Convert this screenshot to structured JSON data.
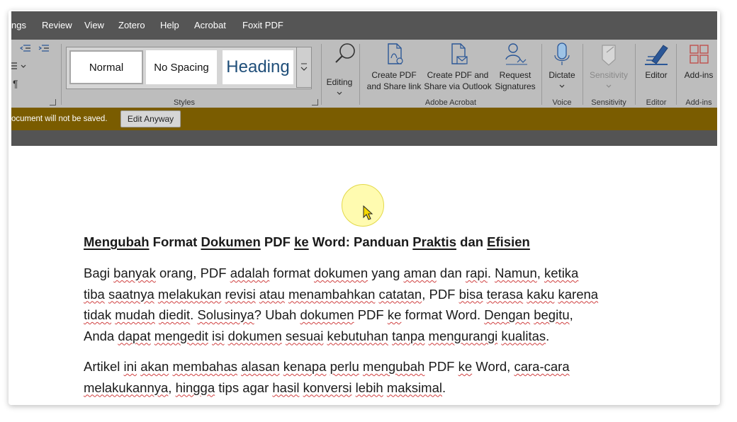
{
  "tabs": [
    "ngs",
    "Review",
    "View",
    "Zotero",
    "Help",
    "Acrobat",
    "Foxit PDF"
  ],
  "styles": {
    "items": [
      "Normal",
      "No Spacing",
      "Heading"
    ],
    "group_label": "Styles"
  },
  "editing": {
    "label": "Editing"
  },
  "acrobat": {
    "create_link": [
      "Create PDF",
      "and Share link"
    ],
    "create_outlook": [
      "Create PDF and",
      "Share via Outlook"
    ],
    "request_sign": [
      "Request",
      "Signatures"
    ],
    "group_label": "Adobe Acrobat"
  },
  "voice": {
    "label": "Dictate",
    "group_label": "Voice"
  },
  "sensitivity": {
    "label": "Sensitivity",
    "group_label": "Sensitivity"
  },
  "editor": {
    "label": "Editor",
    "group_label": "Editor"
  },
  "addins": {
    "label": "Add-ins",
    "group_label": "Add-ins"
  },
  "infobar": {
    "message": "ocument will not be saved.",
    "button": "Edit Anyway"
  },
  "document": {
    "heading": [
      {
        "t": "Mengubah",
        "u": true
      },
      {
        "t": " Format ",
        "u": false
      },
      {
        "t": "Dokumen",
        "u": true
      },
      {
        "t": " PDF ",
        "u": false
      },
      {
        "t": "ke",
        "u": true
      },
      {
        "t": " Word: Panduan ",
        "u": false
      },
      {
        "t": "Praktis",
        "u": true
      },
      {
        "t": " dan ",
        "u": false
      },
      {
        "t": "Efisien",
        "u": true
      }
    ],
    "para1": [
      [
        {
          "t": "Bagi ",
          "u": false
        },
        {
          "t": "banyak",
          "u": true
        },
        {
          "t": " orang, PDF ",
          "u": false
        },
        {
          "t": "adalah",
          "u": true
        },
        {
          "t": " format ",
          "u": false
        },
        {
          "t": "dokumen",
          "u": true
        },
        {
          "t": " yang ",
          "u": false
        },
        {
          "t": "aman",
          "u": true
        },
        {
          "t": " dan ",
          "u": false
        },
        {
          "t": "rapi",
          "u": true
        },
        {
          "t": ". ",
          "u": false
        },
        {
          "t": "Namun",
          "u": true
        },
        {
          "t": ", ",
          "u": false
        },
        {
          "t": "ketika",
          "u": true
        }
      ],
      [
        {
          "t": "tiba",
          "u": true
        },
        {
          "t": " ",
          "u": false
        },
        {
          "t": "saatnya",
          "u": true
        },
        {
          "t": " ",
          "u": false
        },
        {
          "t": "melakukan",
          "u": true
        },
        {
          "t": " ",
          "u": false
        },
        {
          "t": "revisi",
          "u": true
        },
        {
          "t": " ",
          "u": false
        },
        {
          "t": "atau",
          "u": true
        },
        {
          "t": " ",
          "u": false
        },
        {
          "t": "menambahkan",
          "u": true
        },
        {
          "t": " ",
          "u": false
        },
        {
          "t": "catatan",
          "u": true
        },
        {
          "t": ", PDF ",
          "u": false
        },
        {
          "t": "bisa",
          "u": true
        },
        {
          "t": " ",
          "u": false
        },
        {
          "t": "terasa",
          "u": true
        },
        {
          "t": " ",
          "u": false
        },
        {
          "t": "kaku",
          "u": true
        },
        {
          "t": " ",
          "u": false
        },
        {
          "t": "karena",
          "u": true
        }
      ],
      [
        {
          "t": "tidak",
          "u": true
        },
        {
          "t": " ",
          "u": false
        },
        {
          "t": "mudah",
          "u": true
        },
        {
          "t": " ",
          "u": false
        },
        {
          "t": "diedit",
          "u": true
        },
        {
          "t": ". ",
          "u": false
        },
        {
          "t": "Solusinya",
          "u": true
        },
        {
          "t": "? Ubah ",
          "u": false
        },
        {
          "t": "dokumen",
          "u": true
        },
        {
          "t": " PDF ",
          "u": false
        },
        {
          "t": "ke",
          "u": true
        },
        {
          "t": " format Word. ",
          "u": false
        },
        {
          "t": "Dengan",
          "u": true
        },
        {
          "t": " ",
          "u": false
        },
        {
          "t": "begitu",
          "u": true
        },
        {
          "t": ",",
          "u": false
        }
      ],
      [
        {
          "t": "Anda ",
          "u": false
        },
        {
          "t": "dapat",
          "u": true
        },
        {
          "t": " ",
          "u": false
        },
        {
          "t": "mengedit",
          "u": true
        },
        {
          "t": " ",
          "u": false
        },
        {
          "t": "isi",
          "u": true
        },
        {
          "t": " ",
          "u": false
        },
        {
          "t": "dokumen",
          "u": true
        },
        {
          "t": " ",
          "u": false
        },
        {
          "t": "sesuai",
          "u": true
        },
        {
          "t": " ",
          "u": false
        },
        {
          "t": "kebutuhan",
          "u": true
        },
        {
          "t": " ",
          "u": false
        },
        {
          "t": "tanpa",
          "u": true
        },
        {
          "t": " ",
          "u": false
        },
        {
          "t": "mengurangi",
          "u": true
        },
        {
          "t": " ",
          "u": false
        },
        {
          "t": "kualitas",
          "u": true
        },
        {
          "t": ".",
          "u": false
        }
      ]
    ],
    "para2": [
      [
        {
          "t": "Artikel ",
          "u": false
        },
        {
          "t": "ini",
          "u": true
        },
        {
          "t": " ",
          "u": false
        },
        {
          "t": "akan",
          "u": true
        },
        {
          "t": " ",
          "u": false
        },
        {
          "t": "membahas",
          "u": true
        },
        {
          "t": " ",
          "u": false
        },
        {
          "t": "alasan",
          "u": true
        },
        {
          "t": " ",
          "u": false
        },
        {
          "t": "kenapa",
          "u": true
        },
        {
          "t": " ",
          "u": false
        },
        {
          "t": "perlu",
          "u": true
        },
        {
          "t": " ",
          "u": false
        },
        {
          "t": "mengubah",
          "u": true
        },
        {
          "t": " PDF ",
          "u": false
        },
        {
          "t": "ke",
          "u": true
        },
        {
          "t": " Word, ",
          "u": false
        },
        {
          "t": "cara-cara",
          "u": true
        }
      ],
      [
        {
          "t": "melakukannya",
          "u": true
        },
        {
          "t": ", ",
          "u": false
        },
        {
          "t": "hingga",
          "u": true
        },
        {
          "t": " tips agar ",
          "u": false
        },
        {
          "t": "hasil",
          "u": true
        },
        {
          "t": " ",
          "u": false
        },
        {
          "t": "konversi",
          "u": true
        },
        {
          "t": " ",
          "u": false
        },
        {
          "t": "lebih",
          "u": true
        },
        {
          "t": " ",
          "u": false
        },
        {
          "t": "maksimal",
          "u": true
        },
        {
          "t": ".",
          "u": false
        }
      ]
    ]
  },
  "colors": {
    "tab_bar": "#555555",
    "ribbon": "#bdbdbd",
    "info_bar": "#7a5c00",
    "accent_blue": "#2b5797",
    "squiggle": "#d04040"
  }
}
